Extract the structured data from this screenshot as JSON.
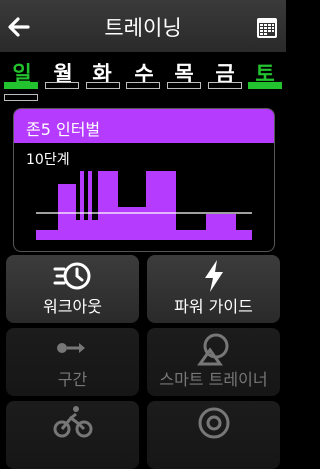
{
  "header": {
    "title": "트레이닝"
  },
  "week": {
    "days": [
      "일",
      "월",
      "화",
      "수",
      "목",
      "금",
      "토"
    ],
    "day_colors": [
      "#22c32e",
      "#ffffff",
      "#ffffff",
      "#ffffff",
      "#ffffff",
      "#ffffff",
      "#22c32e"
    ],
    "green": "#22c32e"
  },
  "workout_card": {
    "title": "존5 인터벌",
    "step_label": "10단계",
    "accent": "#b53bff"
  },
  "menu": {
    "workout": "워크아웃",
    "power_guide": "파워 가이드",
    "segments": "구간",
    "smart_trainer": "스마트 트레이너"
  }
}
